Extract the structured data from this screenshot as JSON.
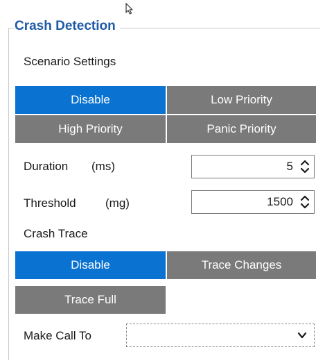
{
  "group": {
    "title": "Crash Detection"
  },
  "scenario": {
    "label": "Scenario Settings",
    "options": [
      {
        "label": "Disable",
        "active": true
      },
      {
        "label": "Low Priority",
        "active": false
      },
      {
        "label": "High Priority",
        "active": false
      },
      {
        "label": "Panic Priority",
        "active": false
      }
    ]
  },
  "duration": {
    "label": "Duration",
    "unit": "(ms)",
    "value": "5"
  },
  "threshold": {
    "label": "Threshold",
    "unit": "(mg)",
    "value": "1500"
  },
  "crash_trace": {
    "label": "Crash Trace",
    "options": [
      {
        "label": "Disable",
        "active": true
      },
      {
        "label": "Trace Changes",
        "active": false
      },
      {
        "label": "Trace Full",
        "active": false
      }
    ]
  },
  "make_call": {
    "label": "Make Call To",
    "value": ""
  },
  "colors": {
    "accent": "#0a72d0",
    "inactive": "#7a7a7a",
    "title": "#1e5aa8"
  },
  "icons": {
    "cursor": "mouse-pointer-icon",
    "spinner": "up-down-arrows-icon",
    "dropdown": "chevron-down-icon"
  }
}
